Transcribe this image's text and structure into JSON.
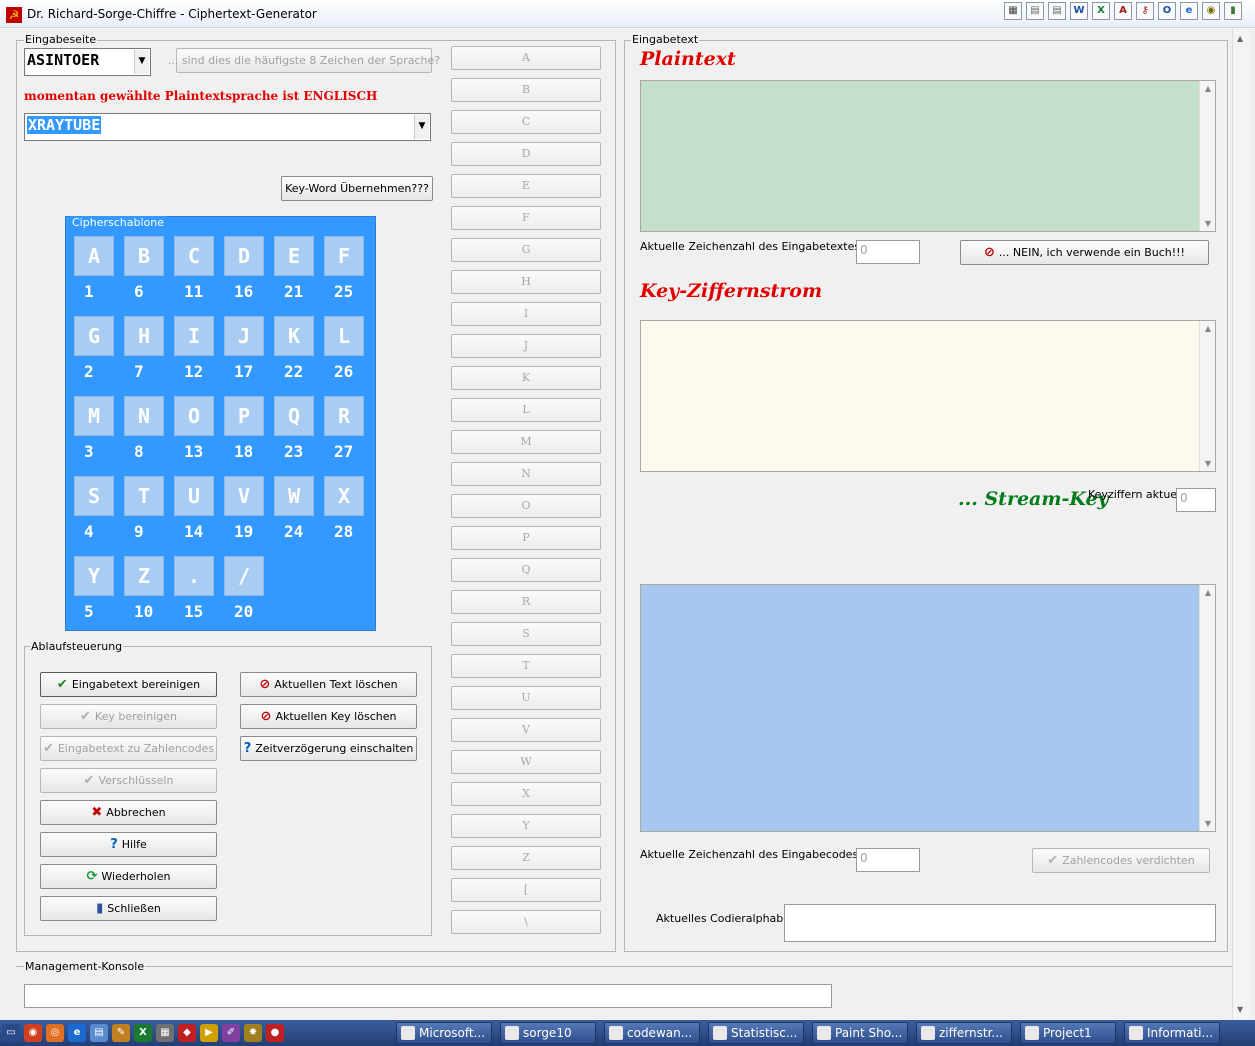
{
  "window": {
    "title": "Dr. Richard-Sorge-Chiffre - Ciphertext-Generator"
  },
  "toolbar_icons": [
    "grid-icon",
    "doc-icon",
    "doc-icon",
    "word-icon",
    "excel-icon",
    "access-icon",
    "key-icon",
    "outlook-icon",
    "ie-icon",
    "camera-icon",
    "chart-icon"
  ],
  "left": {
    "group_label": "Eingabeseite",
    "combo1_value": "ASINTOER",
    "frequency_button": "... sind dies die häufigste 8 Zeichen der Sprache?",
    "language_status": "momentan gewählte Plaintextsprache ist ENGLISCH",
    "combo2_value": "XRAYTUBE",
    "keyword_button": "Key-Word Übernehmen???",
    "cipher_label": "Cipherschablone",
    "cipher_keys": [
      {
        "letter": "A",
        "num": "1"
      },
      {
        "letter": "B",
        "num": "6"
      },
      {
        "letter": "C",
        "num": "11"
      },
      {
        "letter": "D",
        "num": "16"
      },
      {
        "letter": "E",
        "num": "21"
      },
      {
        "letter": "F",
        "num": "25"
      },
      {
        "letter": "G",
        "num": "2"
      },
      {
        "letter": "H",
        "num": "7"
      },
      {
        "letter": "I",
        "num": "12"
      },
      {
        "letter": "J",
        "num": "17"
      },
      {
        "letter": "K",
        "num": "22"
      },
      {
        "letter": "L",
        "num": "26"
      },
      {
        "letter": "M",
        "num": "3"
      },
      {
        "letter": "N",
        "num": "8"
      },
      {
        "letter": "O",
        "num": "13"
      },
      {
        "letter": "P",
        "num": "18"
      },
      {
        "letter": "Q",
        "num": "23"
      },
      {
        "letter": "R",
        "num": "27"
      },
      {
        "letter": "S",
        "num": "4"
      },
      {
        "letter": "T",
        "num": "9"
      },
      {
        "letter": "U",
        "num": "14"
      },
      {
        "letter": "V",
        "num": "19"
      },
      {
        "letter": "W",
        "num": "24"
      },
      {
        "letter": "X",
        "num": "28"
      },
      {
        "letter": "Y",
        "num": "5"
      },
      {
        "letter": "Z",
        "num": "10"
      },
      {
        "letter": ".",
        "num": "15"
      },
      {
        "letter": "/",
        "num": "20"
      }
    ],
    "flow_label": "Ablaufsteuerung",
    "flow_buttons": {
      "clean_text": "Eingabetext bereinigen",
      "clean_key": "Key bereinigen",
      "to_codes": "Eingabetext zu Zahlencodes",
      "encrypt": "Verschlüsseln",
      "abort": "Abbrechen",
      "help": "Hilfe",
      "repeat": "Wiederholen",
      "close": "Schließen",
      "delete_text": "Aktuellen Text löschen",
      "delete_key": "Aktuellen Key löschen",
      "delay": "Zeitverzögerung einschalten"
    }
  },
  "letters": [
    "A",
    "B",
    "C",
    "D",
    "E",
    "F",
    "G",
    "H",
    "I",
    "J",
    "K",
    "L",
    "M",
    "N",
    "O",
    "P",
    "Q",
    "R",
    "S",
    "T",
    "U",
    "V",
    "W",
    "X",
    "Y",
    "Z",
    "[",
    "\\"
  ],
  "right": {
    "group_label": "Eingabetext",
    "plaintext_heading": "Plaintext",
    "char_count_label": "Aktuelle Zeichenzahl des Eingabetextes",
    "char_count_value": "0",
    "book_button": "... NEIN, ich verwende ein Buch!!!",
    "key_heading": "Key-Ziffernstrom",
    "stream_heading": "... Stream-Key",
    "key_digits_label": "Keyziffern aktuell",
    "key_digits_value": "0",
    "code_count_label": "Aktuelle Zeichenzahl des Eingabecodes",
    "code_count_value": "0",
    "compress_button": "Zahlencodes verdichten",
    "alphabet_label": "Aktuelles Codieralphabet",
    "colors": {
      "plaintext_bg": "#c4e0cc",
      "key_bg": "#fcf9ef",
      "codes_bg": "#a6c8ef",
      "heading_red": "#e00000",
      "heading_green": "#007a1a"
    }
  },
  "console": {
    "label": "Management-Konsole"
  },
  "taskbar": {
    "quick_icons": [
      "show-desktop-icon",
      "chrome-icon",
      "firefox-icon",
      "ie-icon",
      "notepad-icon",
      "paint-icon",
      "excel-icon",
      "calc-icon",
      "pdf-icon",
      "media-icon",
      "brush-icon",
      "tool-icon",
      "stop-icon"
    ],
    "tasks": [
      "Microsoft...",
      "sorge10",
      "codewan...",
      "Statistisc...",
      "Paint Sho...",
      "ziffernstr...",
      "Project1",
      "Informati..."
    ]
  }
}
